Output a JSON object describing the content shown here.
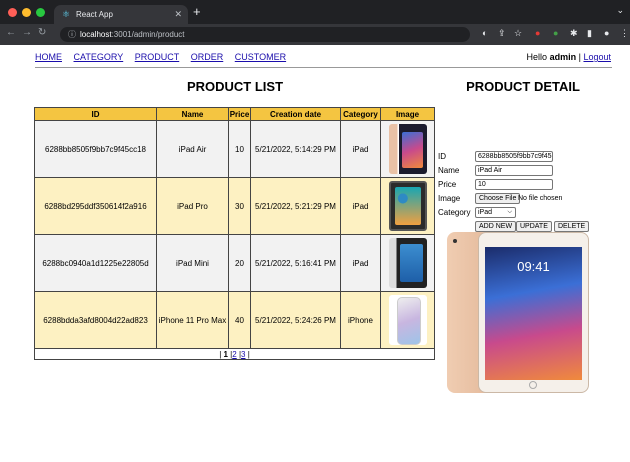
{
  "browser": {
    "tab_title": "React App",
    "url_host": "localhost",
    "url_rest": ":3001/admin/product"
  },
  "menu": {
    "items": [
      "HOME",
      "CATEGORY",
      "PRODUCT",
      "ORDER",
      "CUSTOMER"
    ],
    "hello_prefix": "Hello",
    "user": "admin",
    "separator": "|",
    "logout": "Logout"
  },
  "product_list": {
    "title": "PRODUCT LIST",
    "headers": [
      "ID",
      "Name",
      "Price",
      "Creation date",
      "Category",
      "Image"
    ],
    "rows": [
      {
        "id": "6288bb8505f9bb7c9f45cc18",
        "name": "iPad Air",
        "price": "10",
        "date": "5/21/2022, 5:14:29 PM",
        "category": "iPad",
        "image": "ipad-air-thumbnail"
      },
      {
        "id": "6288bd295ddf350614f2a916",
        "name": "iPad Pro",
        "price": "30",
        "date": "5/21/2022, 5:21:29 PM",
        "category": "iPad",
        "image": "ipad-pro-thumbnail"
      },
      {
        "id": "6288bc0940a1d1225e22805d",
        "name": "iPad Mini",
        "price": "20",
        "date": "5/21/2022, 5:16:41 PM",
        "category": "iPad",
        "image": "ipad-mini-thumbnail"
      },
      {
        "id": "6288bdda3afd8004d22ad823",
        "name": "iPhone 11 Pro Max",
        "price": "40",
        "date": "5/21/2022, 5:24:26 PM",
        "category": "iPhone",
        "image": "iphone-thumbnail"
      }
    ],
    "pager": {
      "current": "1",
      "p2": "2",
      "p3": "3"
    }
  },
  "product_detail": {
    "title": "PRODUCT DETAIL",
    "labels": {
      "id": "ID",
      "name": "Name",
      "price": "Price",
      "image": "Image",
      "category": "Category"
    },
    "values": {
      "id": "6288bb8505f9bb7c9f45cc18",
      "name": "iPad Air",
      "price": "10"
    },
    "file_button": "Choose File",
    "file_status": "No file chosen",
    "category_selected": "iPad",
    "buttons": {
      "add": "ADD NEW",
      "update": "UPDATE",
      "delete": "DELETE"
    },
    "big_image_time": "09:41"
  }
}
